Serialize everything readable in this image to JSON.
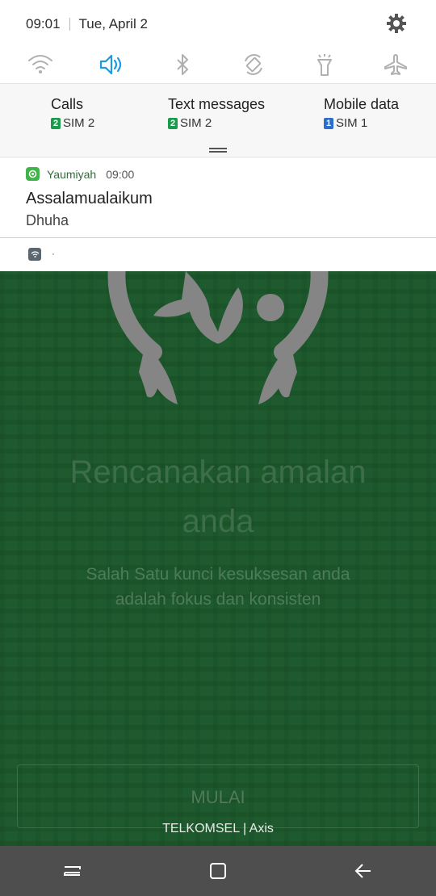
{
  "status": {
    "time": "09:01",
    "date": "Tue, April 2"
  },
  "icons": {
    "settings": "gear-icon",
    "quick_settings": [
      "wifi-icon",
      "sound-icon",
      "bluetooth-icon",
      "auto-rotate-icon",
      "flashlight-icon",
      "airplane-mode-icon"
    ],
    "active_color": "#1e9be0",
    "inactive_color": "#b0b0b0"
  },
  "sim": {
    "calls": {
      "label": "Calls",
      "sim_number": "2",
      "sim": "SIM 2",
      "color": "#1c9a4c"
    },
    "texts": {
      "label": "Text messages",
      "sim_number": "2",
      "sim": "SIM 2",
      "color": "#1c9a4c"
    },
    "data": {
      "label": "Mobile data",
      "sim_number": "1",
      "sim": "SIM 1",
      "color": "#2b6fc9"
    }
  },
  "notification": {
    "app": "Yaumiyah",
    "time": "09:00",
    "title": "Assalamualaikum",
    "body": "Dhuha",
    "app_color": "#3fb549"
  },
  "wifi_notice": {
    "text": "·"
  },
  "app": {
    "title_line1": "Rencanakan amalan",
    "title_line2": "anda",
    "subtitle_line1": "Salah Satu kunci kesuksesan anda",
    "subtitle_line2": "adalah fokus dan konsisten",
    "button": "MULAI",
    "background": "#1e5a2d"
  },
  "carrier": "TELKOMSEL | Axis",
  "nav": {
    "recent": "recent-apps-icon",
    "home": "home-icon",
    "back": "back-icon"
  }
}
